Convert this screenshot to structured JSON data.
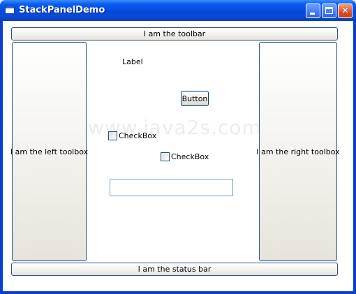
{
  "window": {
    "title": "StackPanelDemo"
  },
  "controls": {
    "toolbar": "I am the toolbar",
    "left_toolbox": "I am the left toolbox",
    "right_toolbox": "I am the right toolbox",
    "status_bar": "I am the status bar",
    "label": "Label",
    "button": "Button",
    "checkbox1": "CheckBox",
    "checkbox2": "CheckBox",
    "textbox_value": ""
  },
  "watermark": "www.java2s.com",
  "colors": {
    "titlebar": "#0548d8",
    "panel_border": "#2e4f8f",
    "close_button": "#d8502a"
  }
}
